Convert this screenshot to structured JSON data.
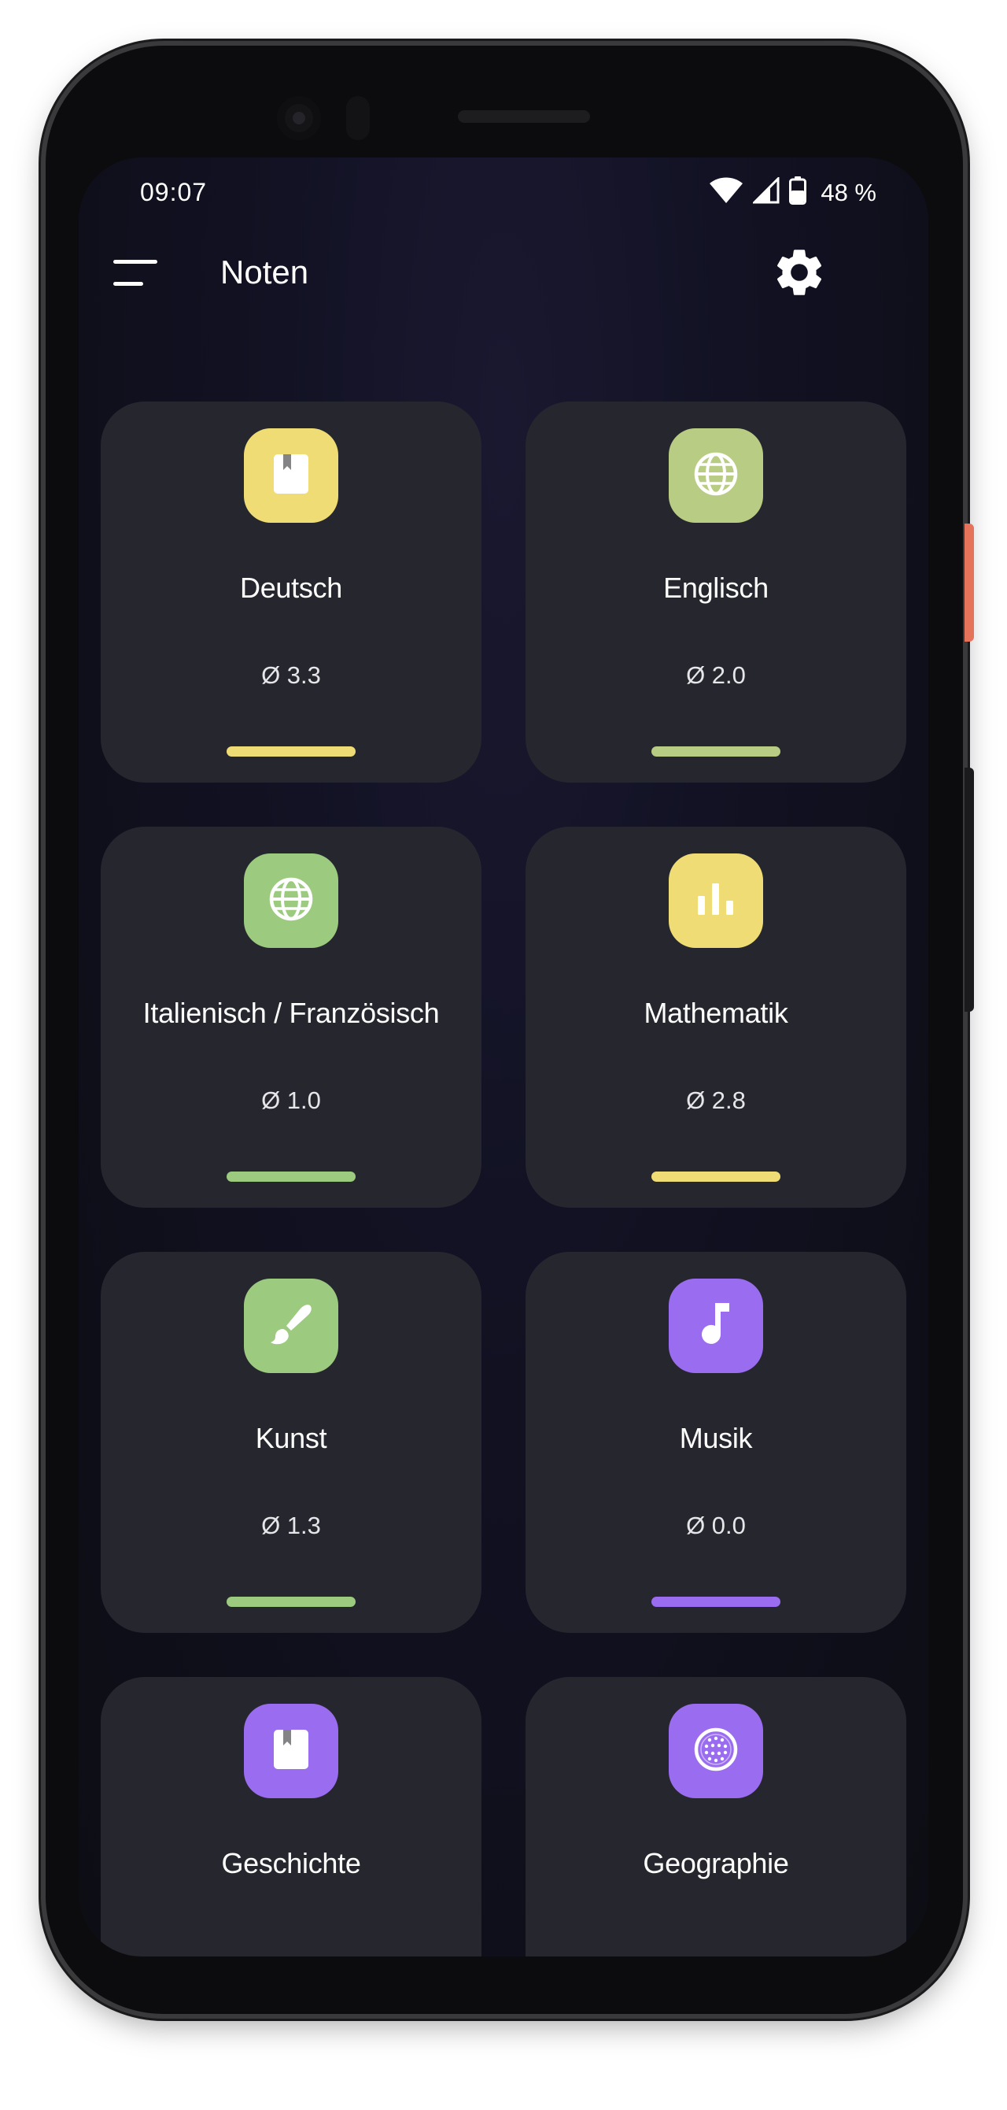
{
  "status_bar": {
    "time": "09:07",
    "battery_text": "48 %",
    "icons": [
      "wifi-icon",
      "signal-icon",
      "battery-icon"
    ]
  },
  "app_bar": {
    "title": "Noten",
    "menu_icon": "menu-icon",
    "settings_icon": "gear-icon"
  },
  "subjects": [
    {
      "name": "Deutsch",
      "average": "Ø 3.3",
      "icon": "book-icon",
      "color": "#f0dc74"
    },
    {
      "name": "Englisch",
      "average": "Ø 2.0",
      "icon": "globe-icon",
      "color": "#b9cc83"
    },
    {
      "name": "Italienisch / Französisch",
      "average": "Ø 1.0",
      "icon": "globe-icon",
      "color": "#9ccb80"
    },
    {
      "name": "Mathematik",
      "average": "Ø 2.8",
      "icon": "chart-icon",
      "color": "#f0dc74"
    },
    {
      "name": "Kunst",
      "average": "Ø 1.3",
      "icon": "brush-icon",
      "color": "#9ccb80"
    },
    {
      "name": "Musik",
      "average": "Ø 0.0",
      "icon": "music-note-icon",
      "color": "#9a6cf0"
    },
    {
      "name": "Geschichte",
      "average": "",
      "icon": "book-icon",
      "color": "#9a6cf0"
    },
    {
      "name": "Geographie",
      "average": "",
      "icon": "globe-dots-icon",
      "color": "#9a6cf0"
    }
  ]
}
